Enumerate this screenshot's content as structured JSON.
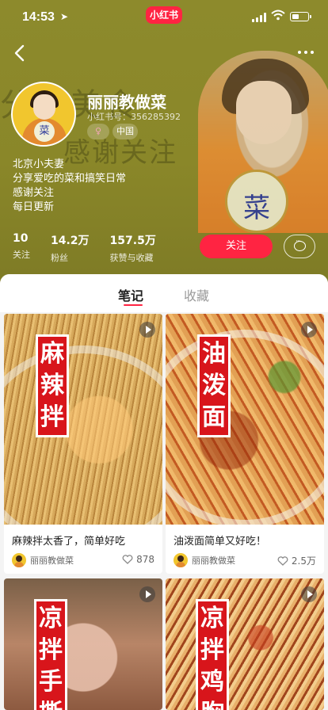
{
  "status": {
    "time": "14:53",
    "app_badge": "小红书"
  },
  "hero": {
    "bg_text_1": "分享美食",
    "bg_text_2": "感谢关注",
    "portrait_badge": "菜"
  },
  "profile": {
    "name": "丽丽教做菜",
    "red_id": "小红书号：356285392",
    "gender_icon": "female-icon",
    "country": "中国",
    "avatar_badge": "菜",
    "bio": [
      "北京小夫妻",
      "分享爱吃的菜和搞笑日常",
      "感谢关注",
      "每日更新"
    ],
    "stats": [
      {
        "num": "10",
        "label": "关注"
      },
      {
        "num": "14.2万",
        "label": "粉丝"
      },
      {
        "num": "157.5万",
        "label": "获赞与收藏"
      }
    ],
    "follow_label": "关注"
  },
  "tabs": [
    {
      "label": "笔记",
      "active": true
    },
    {
      "label": "收藏",
      "active": false
    }
  ],
  "notes": [
    {
      "title": "麻辣拌太香了，简单好吃",
      "label": "麻辣拌",
      "author": "丽丽教做菜",
      "likes": "878",
      "video": true
    },
    {
      "title": "油泼面简单又好吃！",
      "label": "油泼面",
      "author": "丽丽教做菜",
      "likes": "2.5万",
      "video": true
    },
    {
      "title": "",
      "label": "凉拌手撕",
      "author": "",
      "likes": "",
      "video": true
    },
    {
      "title": "",
      "label": "凉拌鸡胸",
      "author": "",
      "likes": "",
      "video": true
    }
  ],
  "colors": {
    "accent": "#ff2442",
    "header_bg": "#8a8729",
    "label_red": "#d8151b"
  }
}
